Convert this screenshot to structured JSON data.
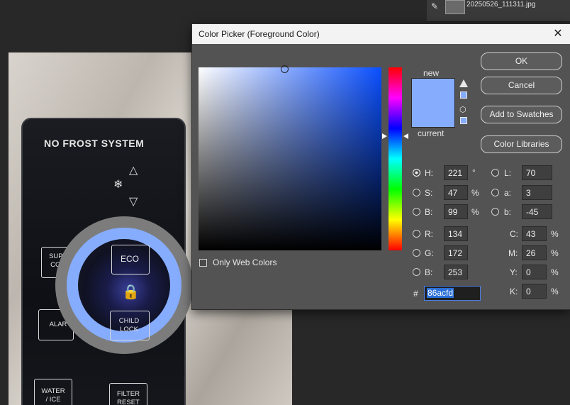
{
  "layers": {
    "filename": "20250526_111311.jpg"
  },
  "photo": {
    "panel_title": "NO FROST SYSTEM",
    "labels": {
      "super_cool": "SUPE\nCOO",
      "alarm": "ALAR",
      "water_ice": "WATER\n/ ICE",
      "filter_reset": "FILTER\nRESET",
      "eco": "ECO",
      "child_lock": "CHILD\nLOCK"
    }
  },
  "dialog": {
    "title": "Color Picker (Foreground Color)",
    "close_label": "✕",
    "new_label": "new",
    "current_label": "current",
    "only_web_colors": "Only Web Colors",
    "buttons": {
      "ok": "OK",
      "cancel": "Cancel",
      "add_to_swatches": "Add to Swatches",
      "color_libraries": "Color Libraries"
    },
    "colors": {
      "new": "#86acfd",
      "current": "#86acfd",
      "accent": "#2b6fd6"
    },
    "hsb": {
      "h": {
        "label": "H:",
        "value": "221",
        "unit": "°"
      },
      "s": {
        "label": "S:",
        "value": "47",
        "unit": "%"
      },
      "b": {
        "label": "B:",
        "value": "99",
        "unit": "%"
      }
    },
    "rgb": {
      "r": {
        "label": "R:",
        "value": "134"
      },
      "g": {
        "label": "G:",
        "value": "172"
      },
      "b": {
        "label": "B:",
        "value": "253"
      }
    },
    "lab": {
      "l": {
        "label": "L:",
        "value": "70"
      },
      "a": {
        "label": "a:",
        "value": "3"
      },
      "b": {
        "label": "b:",
        "value": "-45"
      }
    },
    "cmyk": {
      "c": {
        "label": "C:",
        "value": "43",
        "unit": "%"
      },
      "m": {
        "label": "M:",
        "value": "26",
        "unit": "%"
      },
      "y": {
        "label": "Y:",
        "value": "0",
        "unit": "%"
      },
      "k": {
        "label": "K:",
        "value": "0",
        "unit": "%"
      }
    },
    "hex": {
      "prefix": "#",
      "value": "86acfd"
    },
    "icons": {
      "warning": "warning-icon",
      "cube": "web-safe-cube-icon"
    }
  }
}
